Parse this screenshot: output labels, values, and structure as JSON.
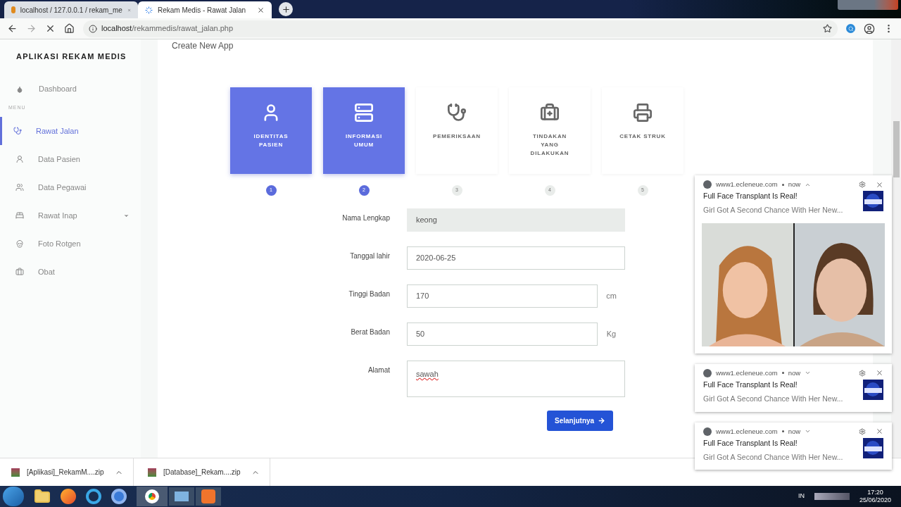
{
  "browser": {
    "tabs": [
      {
        "title": "localhost / 127.0.0.1 / rekam_me",
        "selected": false,
        "loading": false
      },
      {
        "title": "Rekam Medis - Rawat Jalan",
        "selected": true,
        "loading": true
      }
    ],
    "url": {
      "host": "localhost",
      "path": "/rekammedis/rawat_jalan.php"
    }
  },
  "sidebar": {
    "brand": "APLIKASI REKAM MEDIS",
    "top_item": {
      "label": "Dashboard",
      "selected": false
    },
    "section": "MENU",
    "items": [
      {
        "label": "Rawat Jalan",
        "selected": true,
        "dropdown": false
      },
      {
        "label": "Data Pasien",
        "selected": false,
        "dropdown": false
      },
      {
        "label": "Data Pegawai",
        "selected": false,
        "dropdown": false
      },
      {
        "label": "Rawat Inap",
        "selected": false,
        "dropdown": true
      },
      {
        "label": "Foto Rotgen",
        "selected": false,
        "dropdown": false
      },
      {
        "label": "Obat",
        "selected": false,
        "dropdown": false
      }
    ]
  },
  "page_title": "Create New App",
  "steps": [
    {
      "label": "IDENTITAS PASIEN",
      "number": "1",
      "active": true
    },
    {
      "label": "INFORMASI UMUM",
      "number": "2",
      "active": true
    },
    {
      "label": "PEMERIKSAAN",
      "number": "3",
      "active": false
    },
    {
      "label": "TINDAKAN YANG DILAKUKAN",
      "number": "4",
      "active": false
    },
    {
      "label": "CETAK STRUK",
      "number": "5",
      "active": false
    }
  ],
  "form": [
    {
      "label": "Nama Lengkap",
      "value": "keong",
      "kind": "text",
      "disabled": true
    },
    {
      "label": "Tanggal lahir",
      "value": "2020-06-25",
      "kind": "text",
      "disabled": false
    },
    {
      "label": "Tinggi Badan",
      "value": "170",
      "kind": "addon",
      "unit": "cm",
      "disabled": false
    },
    {
      "label": "Berat Badan",
      "value": "50",
      "kind": "addon",
      "unit": "Kg",
      "disabled": false
    },
    {
      "label": "Alamat",
      "value": "sawah",
      "kind": "textarea",
      "disabled": false
    }
  ],
  "next_button": "Selanjutnya",
  "notifications": [
    {
      "site": "www1.ecleneue.com",
      "time": "now",
      "expanded": true,
      "title": "Full Face Transplant Is Real!",
      "body": "Girl Got A Second Chance With Her New..."
    },
    {
      "site": "www1.ecleneue.com",
      "time": "now",
      "expanded": false,
      "title": "Full Face Transplant Is Real!",
      "body": "Girl Got A Second Chance With Her New..."
    },
    {
      "site": "www1.ecleneue.com",
      "time": "now",
      "expanded": false,
      "title": "Full Face Transplant Is Real!",
      "body": "Girl Got A Second Chance With Her New..."
    }
  ],
  "downloads": [
    {
      "name": "[Aplikasi]_RekamM....zip"
    },
    {
      "name": "[Database]_Rekam....zip"
    }
  ],
  "taskbar": {
    "language": "IN",
    "time": "17:20",
    "date": "25/06/2020"
  }
}
